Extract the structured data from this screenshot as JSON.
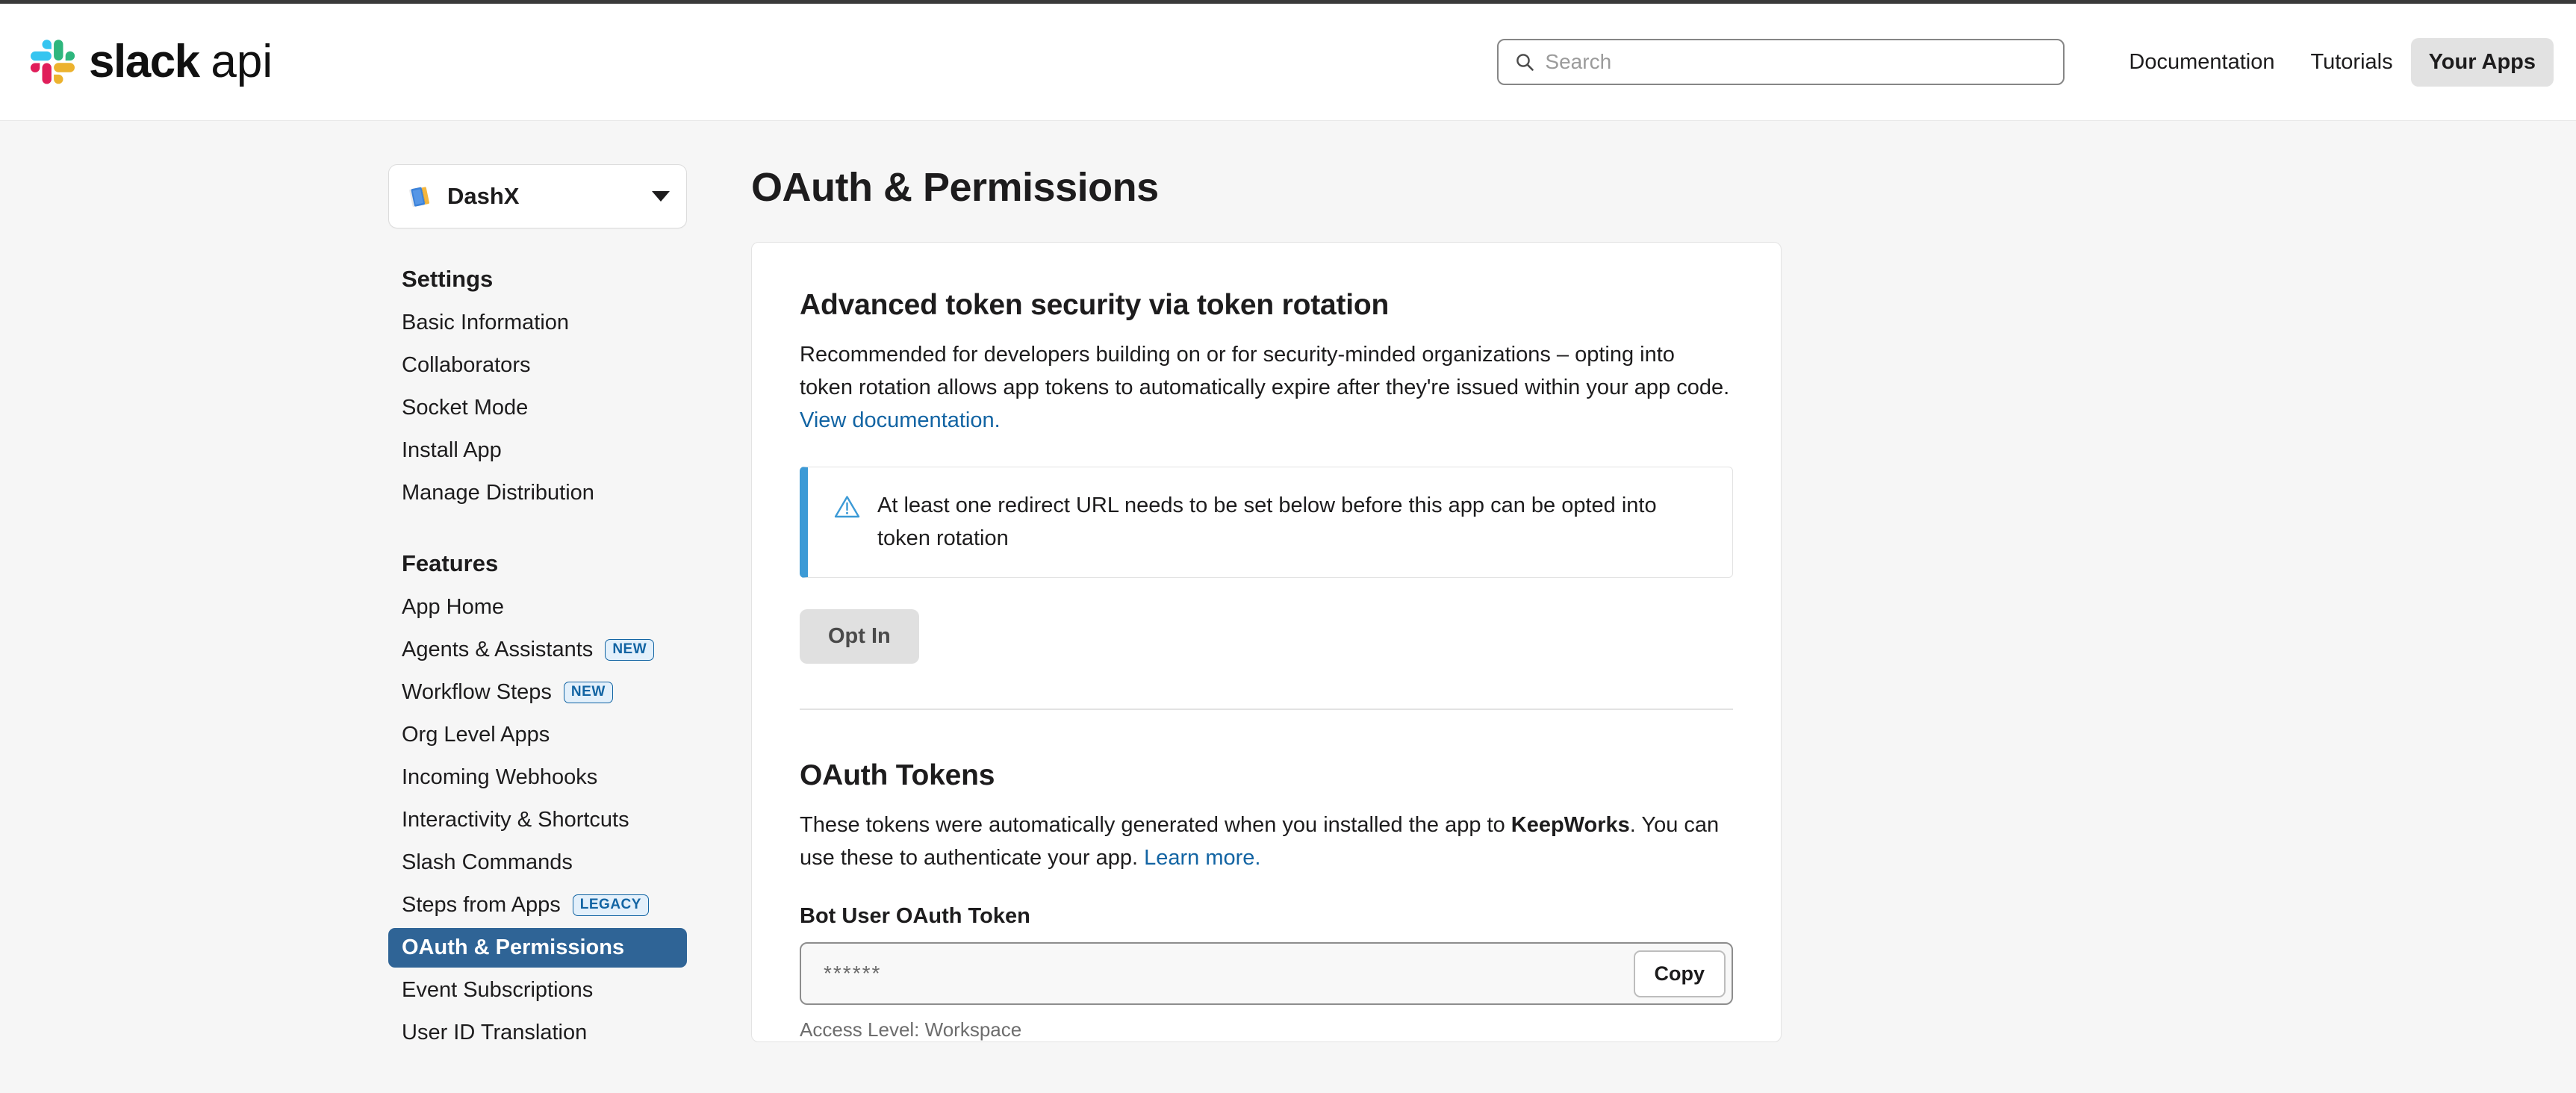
{
  "brand": {
    "name": "slack",
    "sub": "api"
  },
  "header": {
    "search": {
      "placeholder": "Search",
      "value": ""
    },
    "nav": [
      {
        "label": "Documentation",
        "active": false
      },
      {
        "label": "Tutorials",
        "active": false
      },
      {
        "label": "Your Apps",
        "active": true
      }
    ]
  },
  "sidebar": {
    "app_selector": {
      "name": "DashX",
      "icon": "books-emoji"
    },
    "groups": [
      {
        "title": "Settings",
        "items": [
          {
            "label": "Basic Information"
          },
          {
            "label": "Collaborators"
          },
          {
            "label": "Socket Mode"
          },
          {
            "label": "Install App"
          },
          {
            "label": "Manage Distribution"
          }
        ]
      },
      {
        "title": "Features",
        "items": [
          {
            "label": "App Home"
          },
          {
            "label": "Agents & Assistants",
            "badge": "NEW"
          },
          {
            "label": "Workflow Steps",
            "badge": "NEW"
          },
          {
            "label": "Org Level Apps"
          },
          {
            "label": "Incoming Webhooks"
          },
          {
            "label": "Interactivity & Shortcuts"
          },
          {
            "label": "Slash Commands"
          },
          {
            "label": "Steps from Apps",
            "badge": "LEGACY"
          },
          {
            "label": "OAuth & Permissions",
            "active": true
          },
          {
            "label": "Event Subscriptions"
          },
          {
            "label": "User ID Translation"
          }
        ]
      }
    ]
  },
  "main": {
    "page_title": "OAuth & Permissions",
    "token_rotation": {
      "title": "Advanced token security via token rotation",
      "body_part1": "Recommended for developers building on or for security-minded organizations – opting into token rotation allows app tokens to automatically expire after they're issued within your app code. ",
      "link_label": "View documentation.",
      "callout_text": "At least one redirect URL needs to be set below before this app can be opted into token rotation",
      "callout_icon": "warning-triangle-icon",
      "button_label": "Opt In"
    },
    "oauth_tokens": {
      "title": "OAuth Tokens",
      "body_part1": "These tokens were automatically generated when you installed the app to ",
      "workspace_name": "KeepWorks",
      "body_part2": ". You can use these to authenticate your app. ",
      "link_label": "Learn more.",
      "field_label": "Bot User OAuth Token",
      "token_value": "******",
      "copy_label": "Copy",
      "access_level": "Access Level: Workspace"
    }
  },
  "colors": {
    "accent_blue": "#1264a3",
    "active_nav_bg": "#2f6496",
    "callout_border": "#3c9ad6",
    "page_bg": "#f6f6f6"
  }
}
